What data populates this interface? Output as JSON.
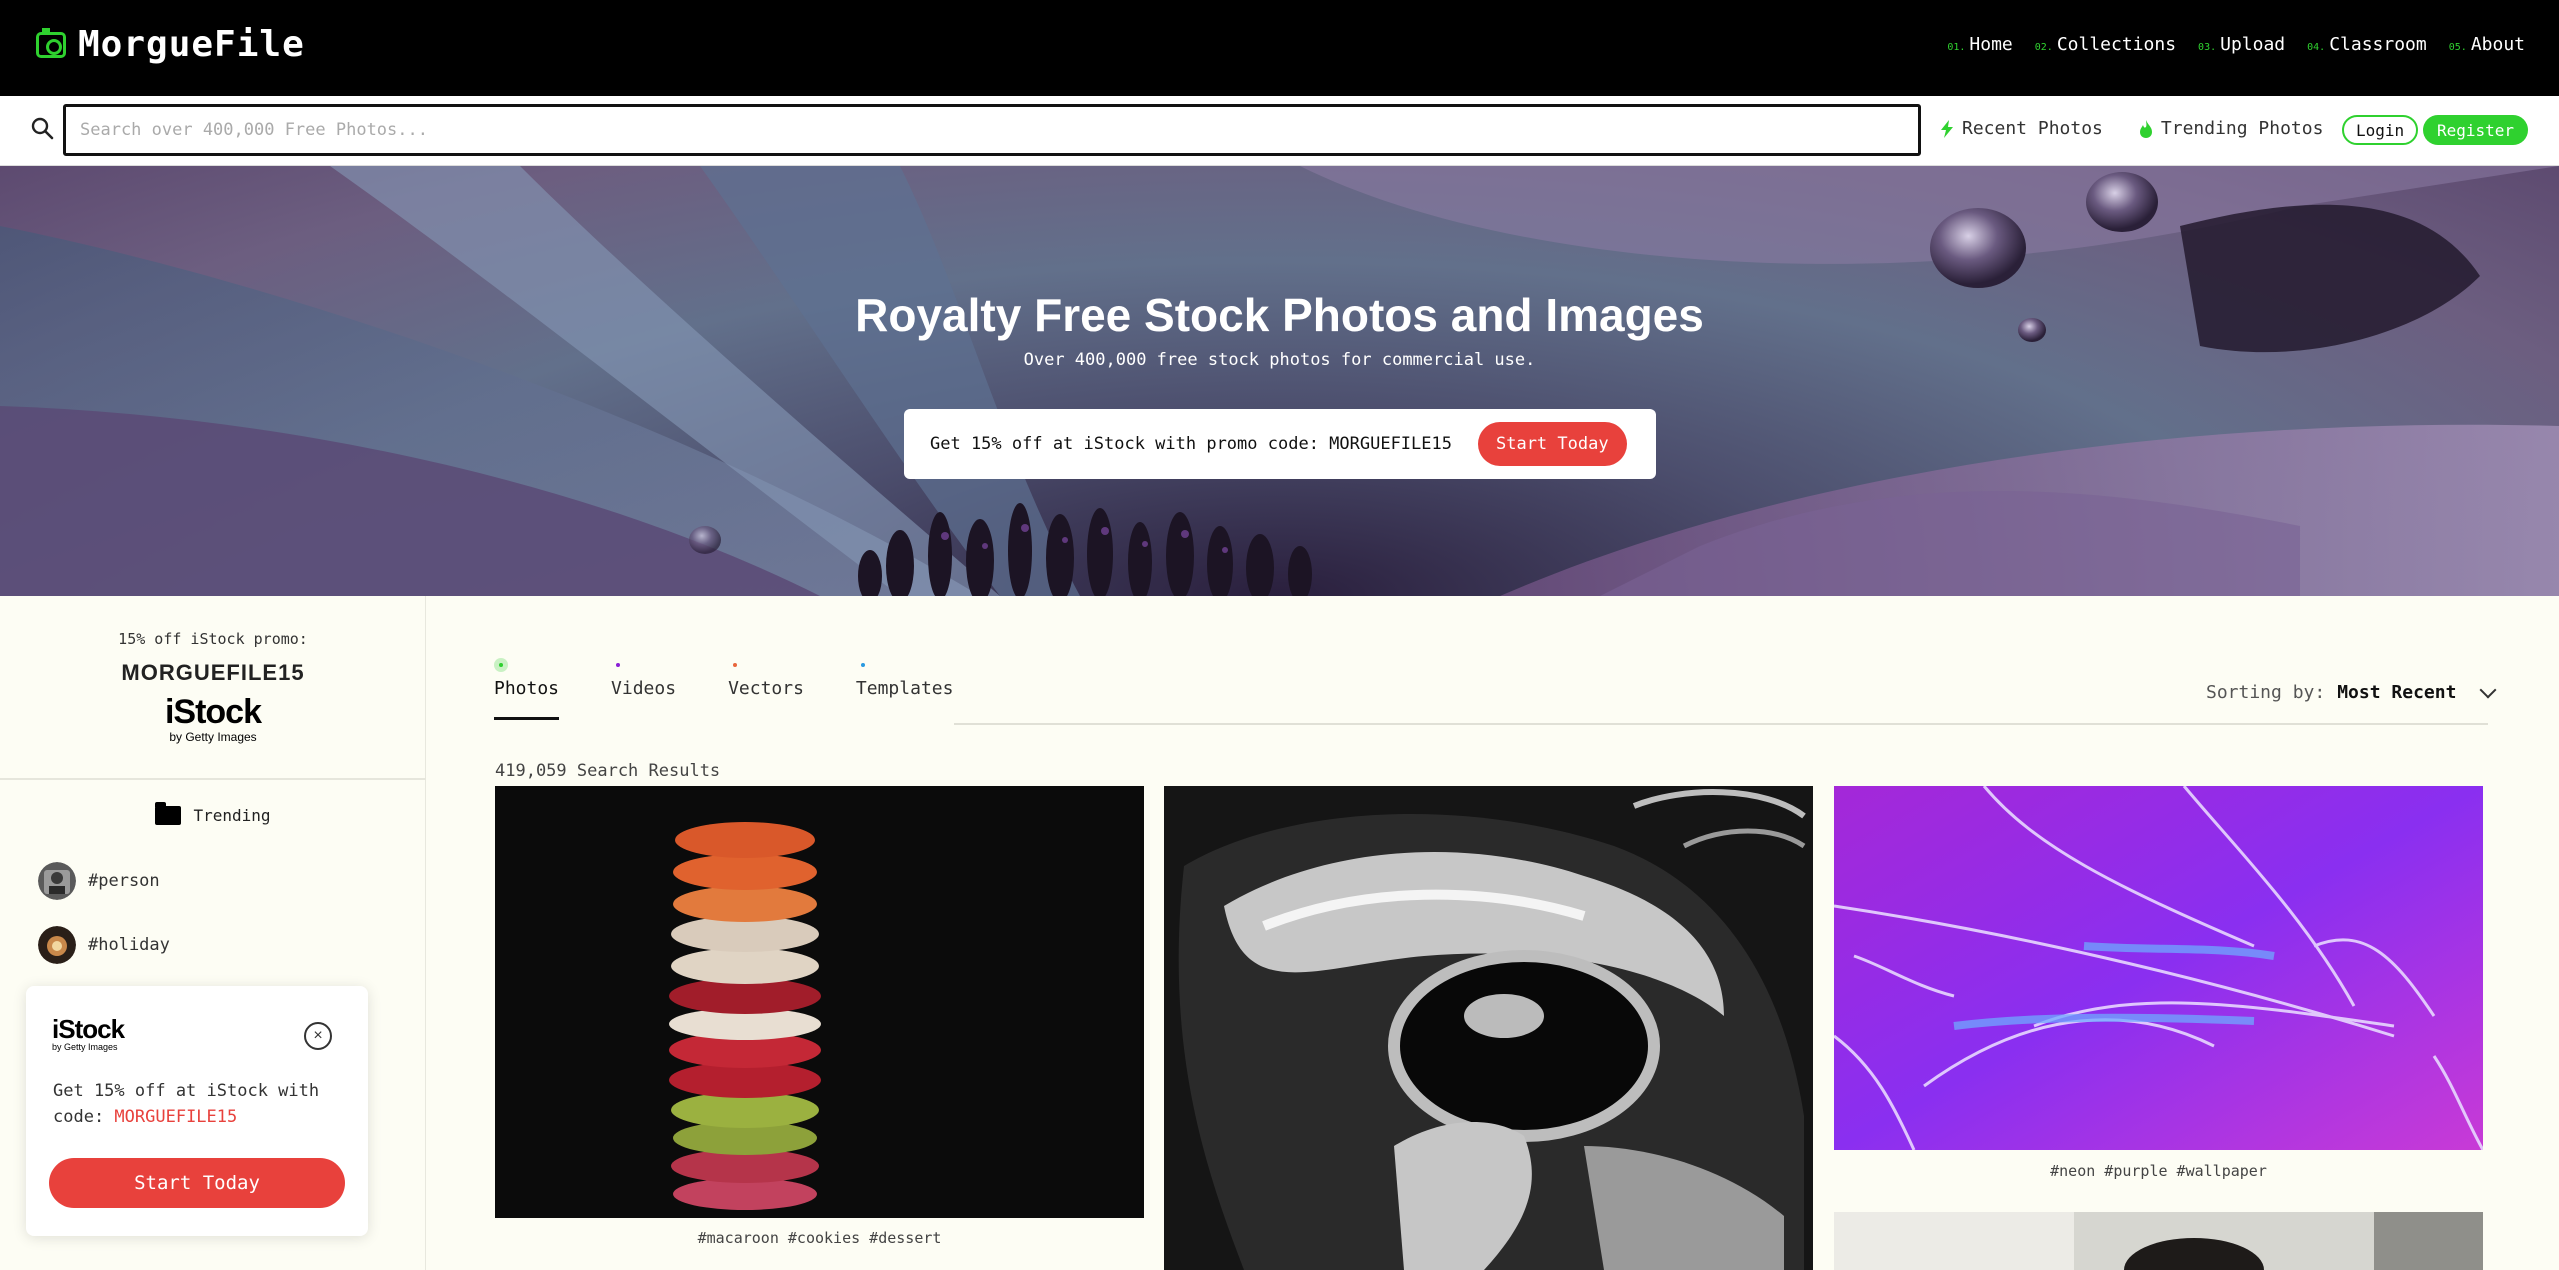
{
  "brand": {
    "name": "MorgueFile",
    "accent": "#2fd12f",
    "promo_red": "#e8413c"
  },
  "nav": {
    "items": [
      {
        "num": "01.",
        "label": "Home"
      },
      {
        "num": "02.",
        "label": "Collections"
      },
      {
        "num": "03.",
        "label": "Upload"
      },
      {
        "num": "04.",
        "label": "Classroom"
      },
      {
        "num": "05.",
        "label": "About"
      }
    ]
  },
  "search": {
    "placeholder": "Search over 400,000 Free Photos...",
    "value": "",
    "recent_label": "Recent Photos",
    "trending_label": "Trending Photos",
    "login_label": "Login",
    "register_label": "Register"
  },
  "hero": {
    "title": "Royalty Free Stock Photos and Images",
    "subtitle": "Over 400,000 free stock photos for commercial use.",
    "promo_text": "Get 15% off at iStock with promo code: MORGUEFILE15",
    "promo_button": "Start Today"
  },
  "sidebar": {
    "promo_label": "15% off iStock promo:",
    "promo_code": "MORGUEFILE15",
    "istock_name": "iStock",
    "istock_tagline": "by Getty Images",
    "trending_label": "Trending",
    "tags": [
      "#person",
      "#holiday"
    ]
  },
  "popup": {
    "istock_name": "iStock",
    "istock_tagline": "by Getty Images",
    "text_before": "Get 15% off at iStock with code: ",
    "code": "MORGUEFILE15",
    "button": "Start Today",
    "close_symbol": "×"
  },
  "content": {
    "tabs": [
      {
        "label": "Photos",
        "color": "#2fd12f",
        "active": true
      },
      {
        "label": "Videos",
        "color": "#8a1fd6",
        "active": false
      },
      {
        "label": "Vectors",
        "color": "#e8663c",
        "active": false
      },
      {
        "label": "Templates",
        "color": "#2a9ae0",
        "active": false
      }
    ],
    "sort_label": "Sorting by:",
    "sort_value": "Most Recent",
    "results_count": "419,059 Search Results",
    "photos": [
      {
        "caption": "#macaroon #cookies #dessert"
      },
      {
        "caption": ""
      },
      {
        "caption": "#neon #purple #wallpaper"
      },
      {
        "caption": ""
      }
    ]
  }
}
